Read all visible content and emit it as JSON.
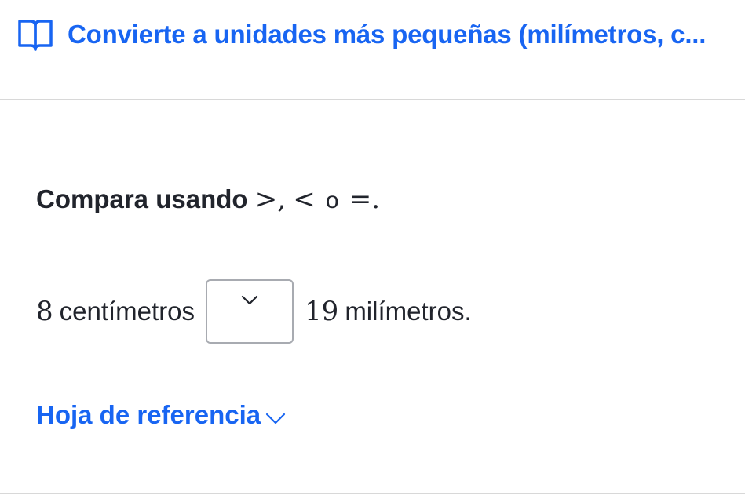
{
  "header": {
    "icon": "book-icon",
    "title": "Convierte a unidades más pequeñas (milímetros, c..."
  },
  "prompt": {
    "text": "Compara usando",
    "symbols": {
      "gt": ">",
      "comma": ",",
      "lt": "<",
      "or": "o",
      "eq": "=",
      "period": "."
    }
  },
  "question": {
    "left_number": "8",
    "left_unit": "centímetros",
    "dropdown_value": "",
    "dropdown_icon": "chevron-down-icon",
    "right_number": "19",
    "right_unit": "milímetros."
  },
  "reference": {
    "label": "Hoja de referencia",
    "icon": "chevron-down-icon"
  },
  "colors": {
    "link": "#1865f2",
    "text": "#21242c",
    "border": "#a8abb1",
    "divider": "#d8d8d8"
  }
}
